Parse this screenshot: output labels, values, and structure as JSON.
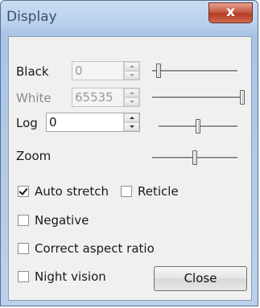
{
  "window": {
    "title": "Display",
    "close_glyph": "x"
  },
  "controls": {
    "black": {
      "label": "Black",
      "value": "0",
      "enabled": false,
      "slider_position": 0.05
    },
    "white": {
      "label": "White",
      "value": "65535",
      "enabled": false,
      "slider_position": 1.0
    },
    "log": {
      "label": "Log",
      "value": "0",
      "enabled": true,
      "slider_position": 0.5
    },
    "zoom": {
      "label": "Zoom",
      "slider_position": 0.5
    }
  },
  "options": {
    "auto_stretch": {
      "label": "Auto stretch",
      "checked": true
    },
    "reticle": {
      "label": "Reticle",
      "checked": false
    },
    "negative": {
      "label": "Negative",
      "checked": false
    },
    "correct_aspect_ratio": {
      "label": "Correct aspect ratio",
      "checked": false
    },
    "night_vision": {
      "label": "Night vision",
      "checked": false
    }
  },
  "buttons": {
    "close_label": "Close"
  },
  "icons": {
    "spin_up": "spin-up-icon",
    "spin_down": "spin-down-icon",
    "close": "close-icon",
    "checkmark": "checkmark-icon"
  }
}
